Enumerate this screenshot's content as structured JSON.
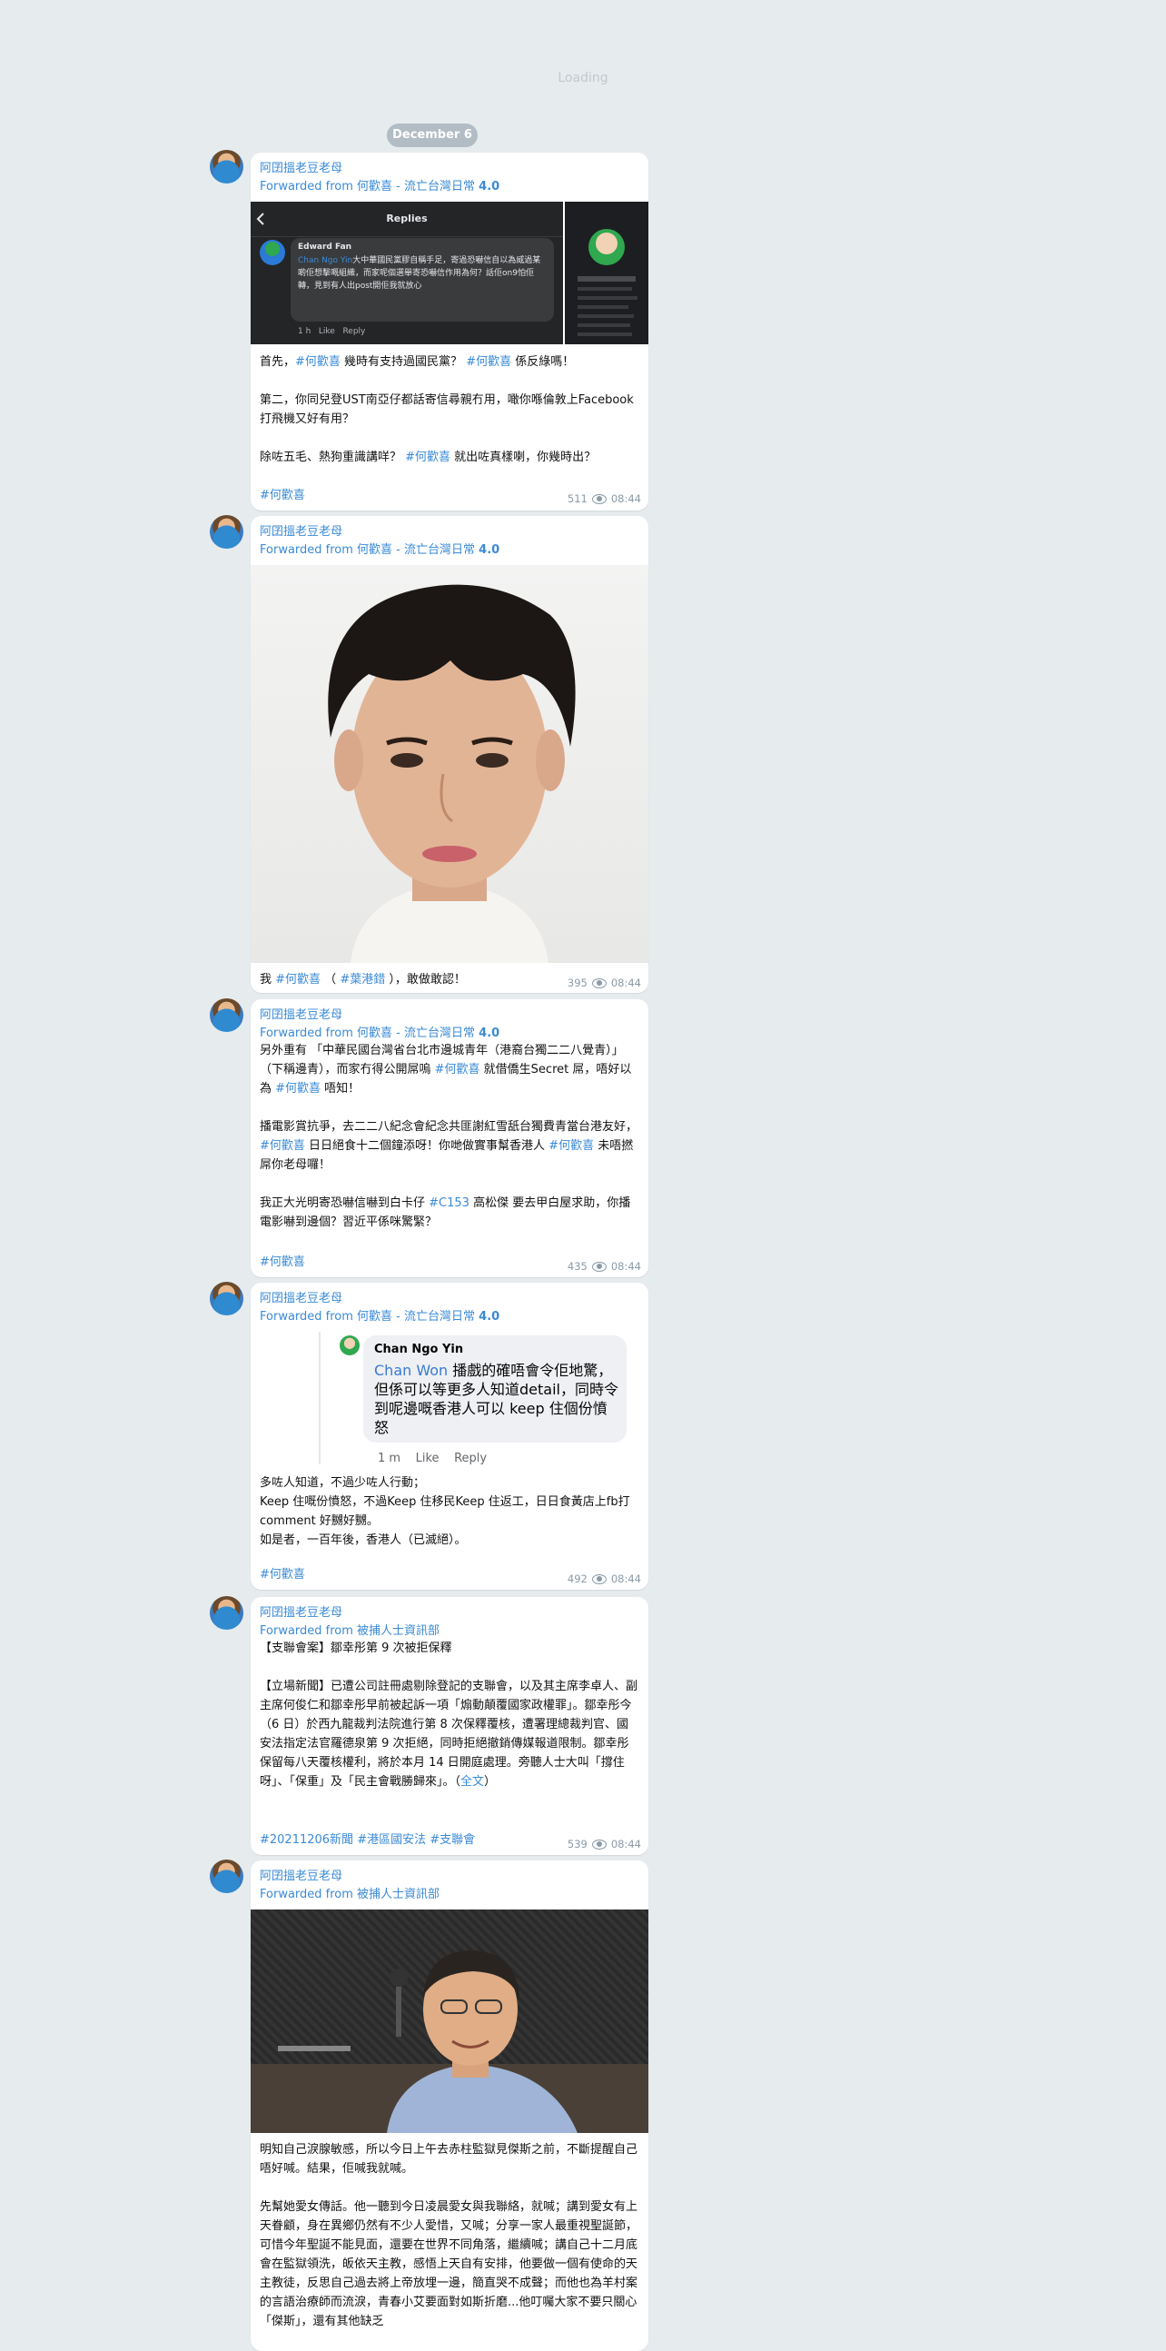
{
  "loading": "Loading",
  "date": "December 6",
  "messages": [
    {
      "sender": "阿囝搵老豆老母",
      "forward_prefix": "Forwarded from ",
      "forward_source": "何歡喜 - 流亡台灣日常",
      "forward_version": "4.0",
      "screenshot": {
        "title": "Replies",
        "author": "Edward Fan",
        "mention": "Chan Ngo Yin",
        "text": "大中華國民黨膠自稱手足，寄過恐嚇信自以為威過某啲佢想擊嘅組織，而家呢個選舉寄恐嚇信作用為何？話佢on9怕佢轉，見到有人出post開佢我就放心",
        "time": "1 h",
        "like": "Like",
        "reply": "Reply"
      },
      "text_parts": [
        [
          "首先，",
          "#何歡喜",
          " 幾時有支持過國民黨？ ",
          "#何歡喜",
          " 係反綠嗎！"
        ],
        [
          "第二，你同兒登UST南亞仔都話寄信尋親冇用，噉你喺倫敦上Facebook 打飛機又好有用？"
        ],
        [
          "除咗五毛、熱狗重識講咩？ ",
          "#何歡喜",
          " 就出咗真樣喇，你幾時出？"
        ]
      ],
      "hashtags": "#何歡喜",
      "views": "511",
      "time": "08:44"
    },
    {
      "sender": "阿囝搵老豆老母",
      "forward_prefix": "Forwarded from ",
      "forward_source": "何歡喜 - 流亡台灣日常",
      "forward_version": "4.0",
      "caption_parts": [
        "我 ",
        "#何歡喜",
        " （ ",
        "#葉港錯",
        " ），敢做敢認！"
      ],
      "views": "395",
      "time": "08:44"
    },
    {
      "sender": "阿囝搵老豆老母",
      "forward_prefix": "Forwarded from ",
      "forward_source": "何歡喜 - 流亡台灣日常",
      "forward_version": "4.0",
      "paragraphs": [
        [
          "另外重有 「中華民國台灣省台北市邊城青年（港裔台獨二二八覺青）」（下稱邊青），而家冇得公開屌嗚 ",
          "#何歡喜",
          " 就借僑生Secret 屌，唔好以為 ",
          "#何歡喜",
          " 唔知！"
        ],
        [
          "播電影賞抗爭，去二二八紀念會紀念共匪謝紅雪舐台獨費青當台港友好， ",
          "#何歡喜",
          " 日日絕食十二個鐘添呀！你哋做實事幫香港人 ",
          "#何歡喜",
          " 未唔撚屌你老母囉！"
        ],
        [
          "我正大光明寄恐嚇信嚇到白卡仔 ",
          "#C153",
          " 高松傑 要去甲白屋求助，你播電影嚇到邊個？習近平係咪驚緊？"
        ]
      ],
      "hashtags": "#何歡喜",
      "views": "435",
      "time": "08:44"
    },
    {
      "sender": "阿囝搵老豆老母",
      "forward_prefix": "Forwarded from ",
      "forward_source": "何歡喜 - 流亡台灣日常",
      "forward_version": "4.0",
      "comment": {
        "author": "Chan Ngo Yin",
        "mention": "Chan Won",
        "text": " 播戲的確唔會令佢地驚，但係可以等更多人知道detail，同時令到呢邊嘅香港人可以 keep 住個份憤怒",
        "time": "1 m",
        "like": "Like",
        "reply": "Reply"
      },
      "text": "多咗人知道，不過少咗人行動；\nKeep 住嘅份憤怒，不過Keep 住移民Keep 住返工，日日食黃店上fb打comment 好嬲好嬲。\n如是者，一百年後，香港人（已滅絕）。",
      "hashtags": "#何歡喜",
      "views": "492",
      "time": "08:44"
    },
    {
      "sender": "阿囝搵老豆老母",
      "forward_prefix": "Forwarded from ",
      "forward_source": "被捕人士資訊部",
      "title": "【支聯會案】鄒幸彤第 9 次被拒保釋",
      "body": "【立場新聞】已遭公司註冊處剔除登記的支聯會，以及其主席李卓人、副主席何俊仁和鄒幸彤早前被起訴一項「煽動顛覆國家政權罪」。鄒幸彤今（6 日）於西九龍裁判法院進行第 8 次保釋覆核，遭署理總裁判官、國安法指定法官羅德泉第 9 次拒絕，同時拒絕撤銷傳媒報道限制。鄒幸彤保留每八天覆核權利，將於本月 14 日開庭處理。旁聽人士大叫「撐住呀」、「保重」及「民主會戰勝歸來」。（",
      "full_link": "全文",
      "body_end": "）",
      "hashtags": "#20211206新聞 #港區國安法 #支聯會",
      "views": "539",
      "time": "08:44"
    },
    {
      "sender": "阿囝搵老豆老母",
      "forward_prefix": "Forwarded from ",
      "forward_source": "被捕人士資訊部",
      "para1": "明知自己淚腺敏感，所以今日上午去赤柱監獄見傑斯之前，不斷提醒自己唔好喊。結果，佢喊我就喊。",
      "para2": "先幫她愛女傳話。他一聽到今日凌晨愛女與我聯絡，就喊；講到愛女有上天眷顧，身在異鄉仍然有不少人愛惜，又喊；分享一家人最重視聖誕節，可惜今年聖誕不能見面，還要在世界不同角落，繼續喊；講自己十二月底會在監獄領洗，皈依天主教，感悟上天自有安排，他要做一個有使命的天主教徒，反思自己過去將上帝放埋一邊，簡直哭不成聲；而他也為羊村案的言語治療師而流淚，青春小艾要面對如斯折磨...他叮囑大家不要只關心「傑斯」，還有其他缺乏"
    }
  ]
}
